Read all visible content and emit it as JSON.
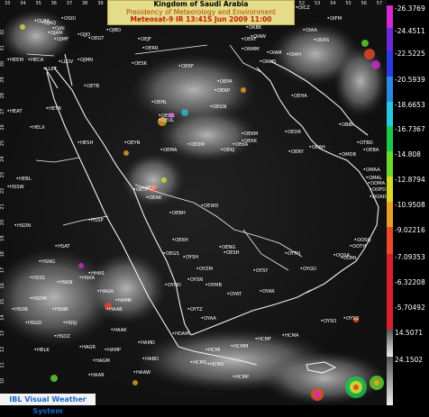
{
  "header": {
    "line1": "Kingdom of Saudi Arabia",
    "line2": "Presidency of Meteorology and Environment",
    "line3": "Meteosat-9 IR 13:41S Jun 2009 11:00"
  },
  "footer": {
    "label": "IBL Visual Weather System"
  },
  "legend": {
    "values": [
      "-26.3769",
      "-24.4511",
      "-22.5225",
      "-20.5939",
      "-18.6653",
      "-16.7367",
      "-14.808",
      "-12.8794",
      "-10.9508",
      "-9.02216",
      "-7.09353",
      "-6.32208",
      "-5.70492",
      "14.5071",
      "24.1502"
    ],
    "colors": {
      "band1": "#d02ad0",
      "band2": "#6a2ad8",
      "band3": "#2a3ae0",
      "band4": "#2a8ae0",
      "band5": "#2ac8e0",
      "band6": "#1ac850",
      "band7": "#68d82a",
      "band8": "#d8d82a",
      "band9": "#e8a02a",
      "band10": "#e84a2a",
      "band11": "#d8202a",
      "grey": "#909090"
    }
  },
  "grid": {
    "lon_labels": [
      "33",
      "34",
      "35",
      "36",
      "37",
      "38",
      "39",
      "40",
      "41",
      "42",
      "43",
      "44",
      "45",
      "46",
      "47",
      "48",
      "49",
      "50",
      "51",
      "52",
      "53",
      "54",
      "55",
      "56",
      "57"
    ],
    "lat_labels": [
      "32",
      "31",
      "30",
      "29",
      "28",
      "27",
      "26",
      "25",
      "24",
      "23",
      "22",
      "21",
      "20",
      "19",
      "18",
      "17",
      "16",
      "15",
      "14",
      "13",
      "12",
      "11",
      "10",
      "9"
    ]
  },
  "stations": [
    {
      "code": "ORBB"
    },
    {
      "code": "OICI"
    },
    {
      "code": "OICZ"
    },
    {
      "code": "OIFM"
    },
    {
      "code": "OJAQ"
    },
    {
      "code": "OJAM"
    },
    {
      "code": "OJAI"
    },
    {
      "code": "OJMF"
    },
    {
      "code": "OLBA"
    },
    {
      "code": "OSDI"
    },
    {
      "code": "OJJO"
    },
    {
      "code": "OEGT"
    },
    {
      "code": "OJBD"
    },
    {
      "code": "OEJF"
    },
    {
      "code": "OERR"
    },
    {
      "code": "OEKF"
    },
    {
      "code": "OKAS"
    },
    {
      "code": "OIAW"
    },
    {
      "code": "OIAA"
    },
    {
      "code": "OIAM"
    },
    {
      "code": "OIAH"
    },
    {
      "code": "ORMM"
    },
    {
      "code": "ORMS"
    },
    {
      "code": "OKBK"
    },
    {
      "code": "HEEM"
    },
    {
      "code": "HECA"
    },
    {
      "code": "LLOV"
    },
    {
      "code": "OJMN"
    },
    {
      "code": "LLET"
    },
    {
      "code": "OESK"
    },
    {
      "code": "OERF"
    },
    {
      "code": "OEHL"
    },
    {
      "code": "OETB"
    },
    {
      "code": "OERP"
    },
    {
      "code": "OEPA"
    },
    {
      "code": "OEHA"
    },
    {
      "code": "HEAT"
    },
    {
      "code": "HETR"
    },
    {
      "code": "OEDS"
    },
    {
      "code": "OEGN"
    },
    {
      "code": "OEUL"
    },
    {
      "code": "OEDM"
    },
    {
      "code": "HELX"
    },
    {
      "code": "OEKM"
    },
    {
      "code": "OEKK"
    },
    {
      "code": "OEKJ"
    },
    {
      "code": "OEDR"
    },
    {
      "code": "OEKA"
    },
    {
      "code": "OBBI"
    },
    {
      "code": "OTBD"
    },
    {
      "code": "HESH"
    },
    {
      "code": "OEYN"
    },
    {
      "code": "OEMA"
    },
    {
      "code": "OERY"
    },
    {
      "code": "OEAH"
    },
    {
      "code": "OEBA"
    },
    {
      "code": "OMDB"
    },
    {
      "code": "OMAA"
    },
    {
      "code": "OMAL"
    },
    {
      "code": "OOMA"
    },
    {
      "code": "HEBL"
    },
    {
      "code": "HSSW"
    },
    {
      "code": "OEJD"
    },
    {
      "code": "OETF"
    },
    {
      "code": "OEAK"
    },
    {
      "code": "OEWD"
    },
    {
      "code": "OOAD"
    },
    {
      "code": "OOFD"
    },
    {
      "code": "OEBH"
    },
    {
      "code": "HSSP"
    },
    {
      "code": "OESH"
    },
    {
      "code": "OENG"
    },
    {
      "code": "OEKH"
    },
    {
      "code": "OEGS"
    },
    {
      "code": "OYSH"
    },
    {
      "code": "OYTH"
    },
    {
      "code": "OOTH"
    },
    {
      "code": "OOML"
    },
    {
      "code": "HSDN"
    },
    {
      "code": "HSAT"
    },
    {
      "code": "OOSA"
    },
    {
      "code": "OOSQ"
    },
    {
      "code": "HSNG"
    },
    {
      "code": "HHAS"
    },
    {
      "code": "OYZM"
    },
    {
      "code": "OYSY"
    },
    {
      "code": "OYGD"
    },
    {
      "code": "HSKA"
    },
    {
      "code": "HAGA"
    },
    {
      "code": "HSSS"
    },
    {
      "code": "HSKN"
    },
    {
      "code": "OYHD"
    },
    {
      "code": "OYSN"
    },
    {
      "code": "OYMB"
    },
    {
      "code": "OYAT"
    },
    {
      "code": "OYAR"
    },
    {
      "code": "HSOB"
    },
    {
      "code": "HSDM"
    },
    {
      "code": "HSNR"
    },
    {
      "code": "HAMK"
    },
    {
      "code": "HAAB"
    },
    {
      "code": "OYTZ"
    },
    {
      "code": "OYAA"
    },
    {
      "code": "OYSQ"
    },
    {
      "code": "HSGD"
    },
    {
      "code": "HSDZ"
    },
    {
      "code": "HAAK"
    },
    {
      "code": "HAMP"
    },
    {
      "code": "HDAM"
    },
    {
      "code": "HCMA"
    },
    {
      "code": "HCMF"
    },
    {
      "code": "HCMM"
    },
    {
      "code": "HCMV"
    },
    {
      "code": "HCMI"
    },
    {
      "code": "HAGR"
    },
    {
      "code": "HAAW"
    },
    {
      "code": "HCMS"
    },
    {
      "code": "HCMP"
    },
    {
      "code": "HAGM"
    },
    {
      "code": "HABD"
    },
    {
      "code": "HBLK"
    },
    {
      "code": "OYSO"
    },
    {
      "code": "HSSJ"
    },
    {
      "code": "HAMD"
    },
    {
      "code": "HAAR"
    }
  ]
}
